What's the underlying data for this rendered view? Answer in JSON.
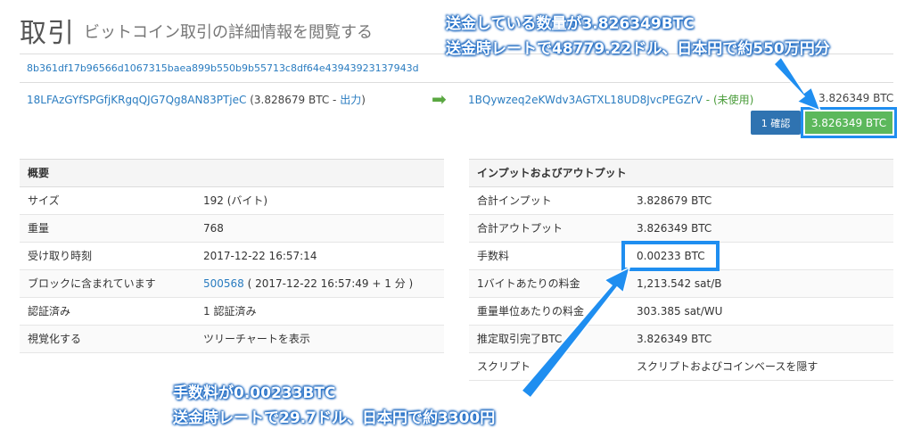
{
  "header": {
    "title": "取引",
    "subtitle": "ビットコイン取引の詳細情報を閲覧する",
    "txid": "8b361df17b96566d1067315baea899b550b9b55713c8df64e43943923137943d"
  },
  "transaction": {
    "input_address": "18LFAzGYfSPGfjKRgqQJG7Qg8AN83PTjeC",
    "input_amount": "(3.828679 BTC - ",
    "input_link": "出力",
    "input_close": ")",
    "output_address": "1BQywzeq2eKWdv3AGTXL18UD8JvcPEGZrV",
    "output_status": "- (未使用)",
    "output_amount": "3.826349 BTC",
    "confirmations": "1 確認",
    "total_button": "3.826349 BTC"
  },
  "summary": {
    "heading": "概要",
    "rows": [
      {
        "label": "サイズ",
        "value": "192 (バイト)"
      },
      {
        "label": "重量",
        "value": "768"
      },
      {
        "label": "受け取り時刻",
        "value": "2017-12-22 16:57:14"
      },
      {
        "label": "ブロックに含まれています",
        "value_link": "500568",
        "value": " ( 2017-12-22 16:57:49 + 1 分 )"
      },
      {
        "label": "認証済み",
        "value": "1 認証済み"
      },
      {
        "label": "視覚化する",
        "value_link": "ツリーチャートを表示"
      }
    ]
  },
  "io": {
    "heading": "インプットおよびアウトプット",
    "rows": [
      {
        "label": "合計インプット",
        "value": "3.828679 BTC"
      },
      {
        "label": "合計アウトプット",
        "value": "3.826349 BTC"
      },
      {
        "label": "手数料",
        "value": "0.00233 BTC"
      },
      {
        "label": "1バイトあたりの料金",
        "value": "1,213.542 sat/B"
      },
      {
        "label": "重量単位あたりの料金",
        "value": "303.385 sat/WU"
      },
      {
        "label": "推定取引完了BTC",
        "value": "3.826349 BTC"
      },
      {
        "label": "スクリプト",
        "value_link": "スクリプトおよびコインベースを隠す"
      }
    ]
  },
  "annotations": {
    "top_line1": "送金している数量が3.826349BTC",
    "top_line2": "送金時レートで48779.22ドル、日本円で約550万円分",
    "bottom_line1": "手数料が0.00233BTC",
    "bottom_line2": "送金時レートで29.7ドル、日本円で約3300円"
  },
  "colors": {
    "link": "#2a7cc0",
    "confirm_button": "#2f73b1",
    "amount_button": "#5cb85c",
    "highlight": "#1f8ef0"
  }
}
